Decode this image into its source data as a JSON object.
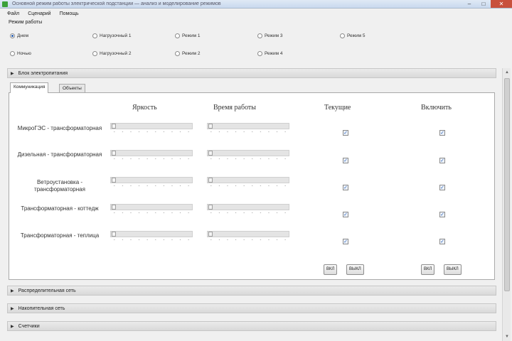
{
  "window": {
    "title": "Основной режим работы электрической подстанции — анализ и моделирование режимов"
  },
  "menu": [
    "Файл",
    "Сценарий",
    "Помощь"
  ],
  "mode": {
    "title": "Режим работы",
    "options": [
      "Днем",
      "Ночью",
      "Нагрузочный 1",
      "Нагрузочный 2",
      "Режим 1",
      "Режим 2",
      "Режим 3",
      "Режим 4",
      "Режим 5"
    ],
    "selected": "Днем"
  },
  "panels": {
    "sources": "Блок электропитания",
    "distribution": "Распределительная сеть",
    "accumulation": "Накопительная сеть",
    "meters": "Счетчики"
  },
  "tabs": [
    "Коммуникация",
    "Объекты"
  ],
  "table": {
    "columns": [
      "Яркость",
      "Время работы",
      "Текущие",
      "Включить"
    ],
    "rows": [
      {
        "label": "МикроГЭС - трансформаторная",
        "brightness": 0,
        "runtime": 0,
        "current": true,
        "enable": true
      },
      {
        "label": "Дизельная - трансформаторная",
        "brightness": 0,
        "runtime": 0,
        "current": true,
        "enable": true
      },
      {
        "label": "Ветроустановка - трансформаторная",
        "brightness": 0,
        "runtime": 0,
        "current": true,
        "enable": true
      },
      {
        "label": "Трансформаторная - коттедж",
        "brightness": 0,
        "runtime": 0,
        "current": true,
        "enable": true
      },
      {
        "label": "Трансформаторная - теплица",
        "brightness": 0,
        "runtime": 0,
        "current": true,
        "enable": true
      }
    ]
  },
  "buttons": {
    "on": "ВКЛ",
    "off": "ВЫКЛ"
  }
}
